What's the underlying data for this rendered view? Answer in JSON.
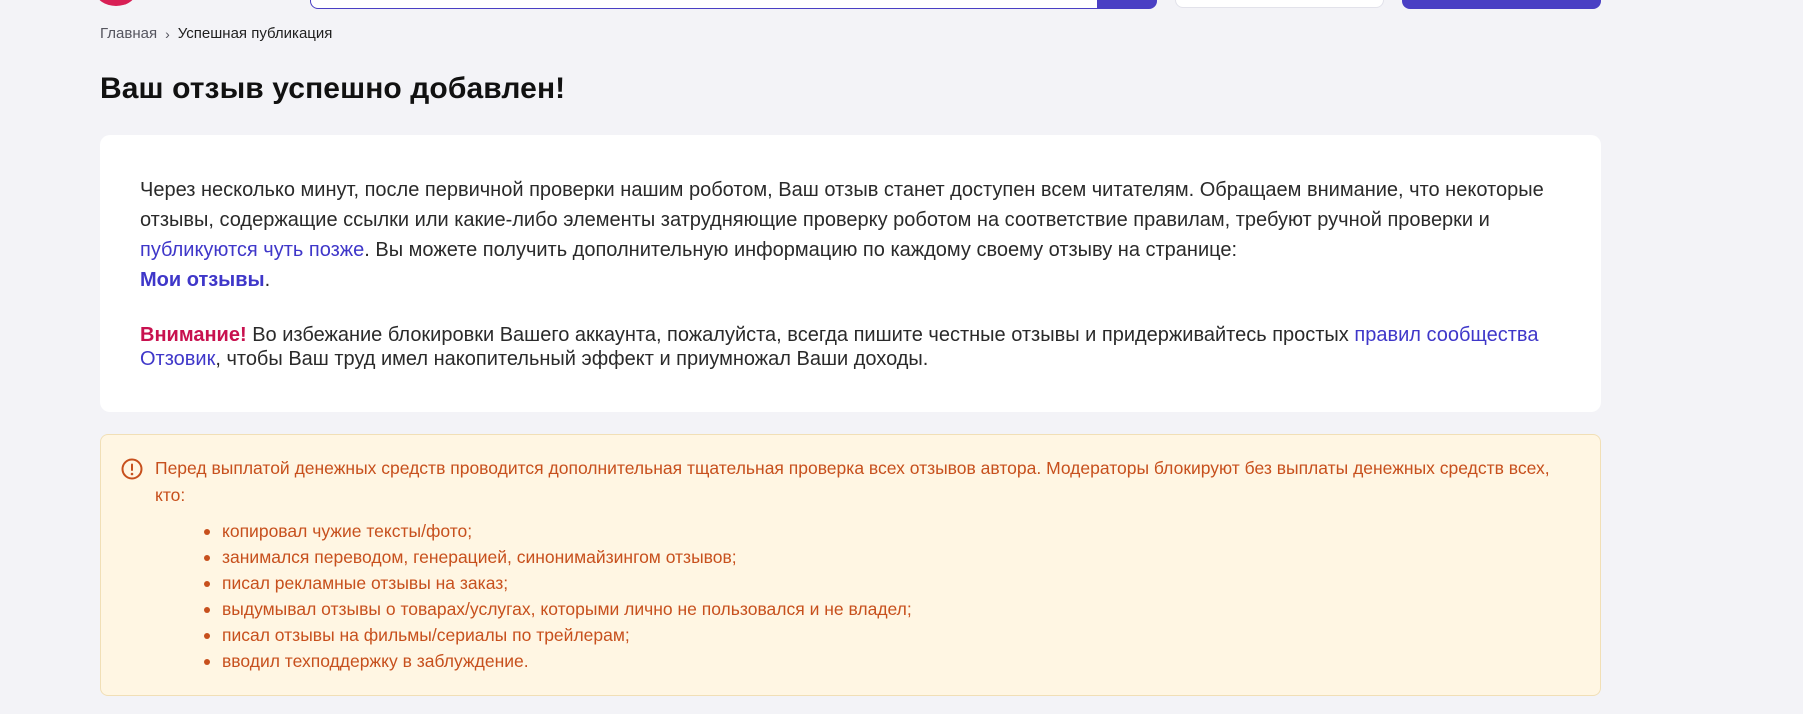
{
  "breadcrumb": {
    "home": "Главная",
    "separator": "›",
    "current": "Успешная публикация"
  },
  "page": {
    "title": "Ваш отзыв успешно добавлен!"
  },
  "success_card": {
    "p1_part1": "Через несколько минут, после первичной проверки нашим роботом, Ваш отзыв станет доступен всем читателям. Обращаем внимание, что некоторые отзывы, содержащие ссылки или какие-либо элементы затрудняющие проверку роботом на соответствие правилам, требуют ручной проверки и ",
    "p1_link": "публикуются чуть позже",
    "p1_part2": ". Вы можете получить дополнительную информацию по каждому своему отзыву на странице: ",
    "my_reviews_link": "Мои отзывы",
    "p1_end": ".",
    "warn_label": "Внимание!",
    "p2_part1": " Во избежание блокировки Вашего аккаунта, пожалуйста, всегда пишите честные отзывы и придерживайтесь простых ",
    "rules_link": "правил сообщества Отзовик",
    "p2_part2": ", чтобы Ваш труд имел накопительный эффект и приумножал Ваши доходы."
  },
  "notice": {
    "icon": "exclamation-circle-icon",
    "text": "Перед выплатой денежных средств проводится дополнительная тщательная проверка всех отзывов автора. Модераторы блокируют без выплаты денежных средств всех, кто:",
    "items": [
      "копировал чужие тексты/фото;",
      "занимался переводом, генерацией, синонимайзингом отзывов;",
      "писал рекламные отзывы на заказ;",
      "выдумывал отзывы о товарах/услугах, которыми лично не пользовался и не владел;",
      "писал отзывы на фильмы/сериалы по трейлерам;",
      "вводил техподдержку в заблуждение."
    ]
  },
  "colors": {
    "accent": "#4a3fc4",
    "link": "#3f37c9",
    "warning_label": "#c8114f",
    "notice_text": "#c7501d",
    "notice_bg": "#fff6e3",
    "page_bg": "#f3f3f7"
  }
}
